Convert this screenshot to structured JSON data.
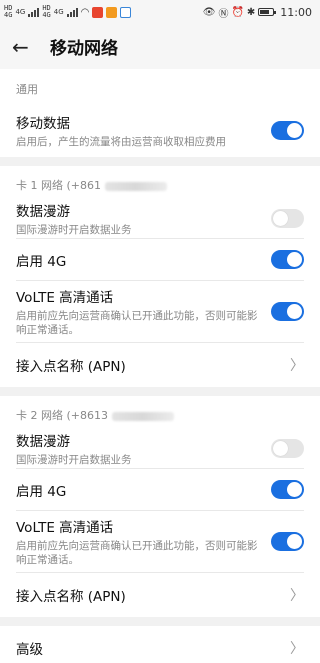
{
  "status": {
    "time": "11:00",
    "sim1_label": "HD",
    "sim1_sub": "4G",
    "sim2_label": "HD",
    "sim2_sub": "4G",
    "net1": "4G",
    "net2": "4G"
  },
  "appbar": {
    "title": "移动网络"
  },
  "general": {
    "section": "通用",
    "mobile_data": {
      "title": "移动数据",
      "sub": "启用后，产生的流量将由运营商收取相应费用",
      "on": true
    }
  },
  "card1": {
    "section": "卡 1 网络 (+861",
    "roaming": {
      "title": "数据漫游",
      "sub": "国际漫游时开启数据业务",
      "on": false
    },
    "lte": {
      "title": "启用 4G",
      "on": true
    },
    "volte": {
      "title": "VoLTE 高清通话",
      "sub": "启用前应先向运营商确认已开通此功能，否则可能影响正常通话。",
      "on": true
    },
    "apn": {
      "title": "接入点名称 (APN)"
    }
  },
  "card2": {
    "section": "卡 2 网络 (+8613",
    "roaming": {
      "title": "数据漫游",
      "sub": "国际漫游时开启数据业务",
      "on": false
    },
    "lte": {
      "title": "启用 4G",
      "on": true
    },
    "volte": {
      "title": "VoLTE 高清通话",
      "sub": "启用前应先向运营商确认已开通此功能，否则可能影响正常通话。",
      "on": true
    },
    "apn": {
      "title": "接入点名称 (APN)"
    }
  },
  "advanced": {
    "title": "高级"
  },
  "colors": {
    "accent": "#1a6fe0",
    "toggle_off": "#e5e5e5",
    "background": "#f1f1f1"
  }
}
